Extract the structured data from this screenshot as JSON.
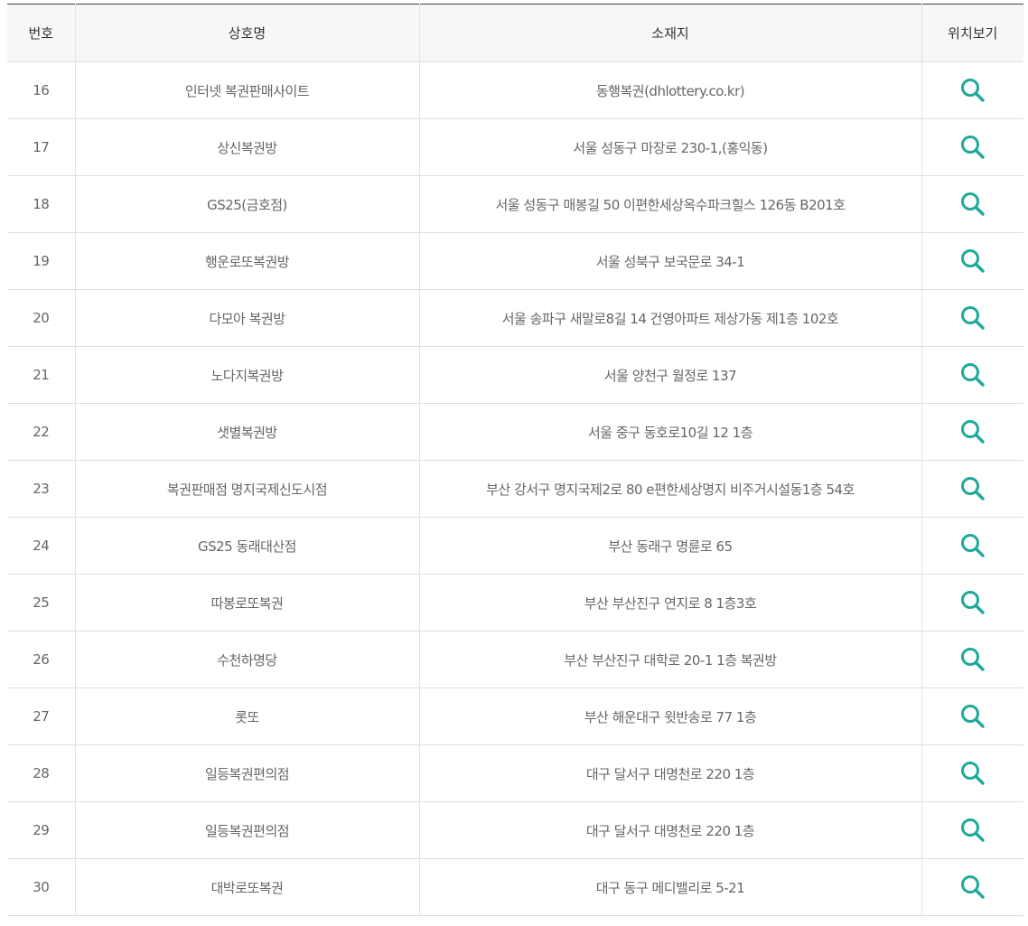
{
  "table": {
    "headers": {
      "no": "번호",
      "name": "상호명",
      "address": "소재지",
      "map": "위치보기"
    },
    "rows": [
      {
        "no": "16",
        "name": "인터넷 복권판매사이트",
        "address": "동행복권(dhlottery.co.kr)"
      },
      {
        "no": "17",
        "name": "상신복권방",
        "address": "서울 성동구 마장로 230-1,(홍익동)"
      },
      {
        "no": "18",
        "name": "GS25(금호점)",
        "address": "서울 성동구 매봉길 50 이편한세상옥수파크힐스 126동 B201호"
      },
      {
        "no": "19",
        "name": "행운로또복권방",
        "address": "서울 성북구 보국문로 34-1"
      },
      {
        "no": "20",
        "name": "다모아 복권방",
        "address": "서울 송파구 새말로8길 14 건영아파트 제상가동 제1층 102호"
      },
      {
        "no": "21",
        "name": "노다지복권방",
        "address": "서울 양천구 월정로 137"
      },
      {
        "no": "22",
        "name": "샛별복권방",
        "address": "서울 중구 동호로10길 12 1층"
      },
      {
        "no": "23",
        "name": "복권판매점 명지국제신도시점",
        "address": "부산 강서구 명지국제2로 80 e편한세상명지 비주거시설동1층 54호"
      },
      {
        "no": "24",
        "name": "GS25 동래대산점",
        "address": "부산 동래구 명륜로 65"
      },
      {
        "no": "25",
        "name": "따봉로또복권",
        "address": "부산 부산진구 연지로 8 1층3호"
      },
      {
        "no": "26",
        "name": "수천하명당",
        "address": "부산 부산진구 대학로 20-1 1층 복권방"
      },
      {
        "no": "27",
        "name": "롯또",
        "address": "부산 해운대구 윗반송로 77 1층"
      },
      {
        "no": "28",
        "name": "일등복권편의점",
        "address": "대구 달서구 대명천로 220 1층"
      },
      {
        "no": "29",
        "name": "일등복권편의점",
        "address": "대구 달서구 대명천로 220 1층"
      },
      {
        "no": "30",
        "name": "대박로또복권",
        "address": "대구 동구 메디밸리로 5-21"
      }
    ]
  },
  "icons": {
    "map_search": "search-icon"
  },
  "colors": {
    "accent": "#1fa99a",
    "header_bg": "#f7f7f7",
    "top_border": "#444444",
    "row_border": "#dddddd",
    "text": "#666666",
    "header_text": "#333333"
  }
}
